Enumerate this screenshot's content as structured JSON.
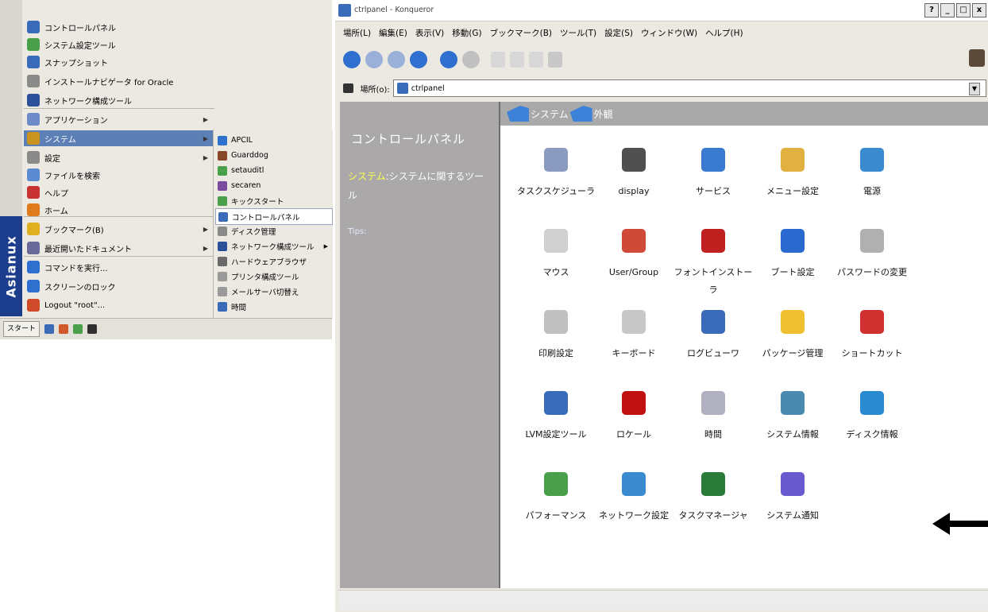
{
  "start_menu": {
    "title": "",
    "brand": "Asianux",
    "items": [
      {
        "label": "コントロールパネル",
        "color": "#3a6bb8",
        "arrow": false
      },
      {
        "label": "システム設定ツール",
        "color": "#4aa04a",
        "arrow": false
      },
      {
        "label": "スナップショット",
        "color": "#3a6bb8",
        "arrow": false
      },
      {
        "label": "インストールナビゲータ for Oracle",
        "color": "#8a8a8a",
        "arrow": false
      },
      {
        "label": "ネットワーク構成ツール",
        "color": "#2c4f9a",
        "arrow": false
      },
      {
        "label": "アプリケーション",
        "color": "#6d8bc6",
        "arrow": true
      },
      {
        "label": "システム",
        "color": "#c8931f",
        "arrow": true
      },
      {
        "label": "設定",
        "color": "#8a8a8a",
        "arrow": true
      },
      {
        "label": "ファイルを検索",
        "color": "#5a8ad0",
        "arrow": false
      },
      {
        "label": "ヘルプ",
        "color": "#c83232",
        "arrow": false
      },
      {
        "label": "ホーム",
        "color": "#e07a1c",
        "arrow": false
      },
      {
        "label": "ブックマーク(B)",
        "color": "#e0b020",
        "arrow": true
      },
      {
        "label": "最近開いたドキュメント",
        "color": "#6a6a9a",
        "arrow": true
      },
      {
        "label": "コマンドを実行...",
        "color": "#2f6fd0",
        "arrow": false
      },
      {
        "label": "スクリーンのロック",
        "color": "#2f6fd0",
        "arrow": false
      },
      {
        "label": "Logout \"root\"...",
        "color": "#d04a2a",
        "arrow": false
      }
    ],
    "submenu": [
      {
        "label": "APCIL",
        "color": "#2f6fd0",
        "arrow": false
      },
      {
        "label": "Guarddog",
        "color": "#8a4a2a",
        "arrow": false
      },
      {
        "label": "setauditl",
        "color": "#4aa04a",
        "arrow": false
      },
      {
        "label": "secaren",
        "color": "#7a4aa0",
        "arrow": false
      },
      {
        "label": "キックスタート",
        "color": "#4aa04a",
        "arrow": false
      },
      {
        "label": "コントロールパネル",
        "color": "#3a6bb8",
        "arrow": false
      },
      {
        "label": "ディスク管理",
        "color": "#8a8a8a",
        "arrow": false
      },
      {
        "label": "ネットワーク構成ツール",
        "color": "#2c4f9a",
        "arrow": true
      },
      {
        "label": "ハードウェアブラウザ",
        "color": "#6a6a6a",
        "arrow": false
      },
      {
        "label": "プリンタ構成ツール",
        "color": "#9a9a9a",
        "arrow": false
      },
      {
        "label": "メールサーバ切替え",
        "color": "#9a9a9a",
        "arrow": false
      },
      {
        "label": "時間",
        "color": "#3a6bb8",
        "arrow": false
      }
    ],
    "taskbar": {
      "start_label": "スタート"
    }
  },
  "window": {
    "title": "ctrlpanel - Konqueror",
    "buttons": [
      "?",
      "_",
      "□",
      "x"
    ],
    "menubar": [
      "場所(L)",
      "編集(E)",
      "表示(V)",
      "移動(G)",
      "ブックマーク(B)",
      "ツール(T)",
      "設定(S)",
      "ウィンドウ(W)",
      "ヘルプ(H)"
    ],
    "location_label": "場所(o):",
    "location_value": "ctrlpanel",
    "nav": {
      "title": "コントロールパネル",
      "desc_highlight": "システム",
      "desc_rest": ":システムに関するツール",
      "tips": "Tips:"
    },
    "tabs": [
      "システム",
      "外観"
    ],
    "items": [
      {
        "label": "タスクスケジューラ",
        "color": "#8a9ac0"
      },
      {
        "label": "display",
        "color": "#505050"
      },
      {
        "label": "サービス",
        "color": "#3a7ad0"
      },
      {
        "label": "メニュー設定",
        "color": "#e0b040"
      },
      {
        "label": "電源",
        "color": "#3a8ad0"
      },
      {
        "label": "マウス",
        "color": "#d0d0d0"
      },
      {
        "label": "User/Group",
        "color": "#d04a3a"
      },
      {
        "label": "フォントインストーラ",
        "color": "#c02020"
      },
      {
        "label": "ブート設定",
        "color": "#2a6ad0"
      },
      {
        "label": "パスワードの変更",
        "color": "#b0b0b0"
      },
      {
        "label": "印刷設定",
        "color": "#c0c0c0"
      },
      {
        "label": "キーボード",
        "color": "#c8c8c8"
      },
      {
        "label": "ログビューワ",
        "color": "#3a6bb8"
      },
      {
        "label": "パッケージ管理",
        "color": "#f0c030"
      },
      {
        "label": "ショートカット",
        "color": "#d03030"
      },
      {
        "label": "LVM設定ツール",
        "color": "#3a6bb8"
      },
      {
        "label": "ロケール",
        "color": "#c01010"
      },
      {
        "label": "時間",
        "color": "#b0b0c0"
      },
      {
        "label": "システム情報",
        "color": "#4a8ab0"
      },
      {
        "label": "ディスク情報",
        "color": "#2a8ad0"
      },
      {
        "label": "パフォーマンス",
        "color": "#4aa04a"
      },
      {
        "label": "ネットワーク設定",
        "color": "#3a8ad0"
      },
      {
        "label": "タスクマネージャ",
        "color": "#2a7a3a"
      },
      {
        "label": "システム通知",
        "color": "#6a5ad0"
      }
    ]
  }
}
